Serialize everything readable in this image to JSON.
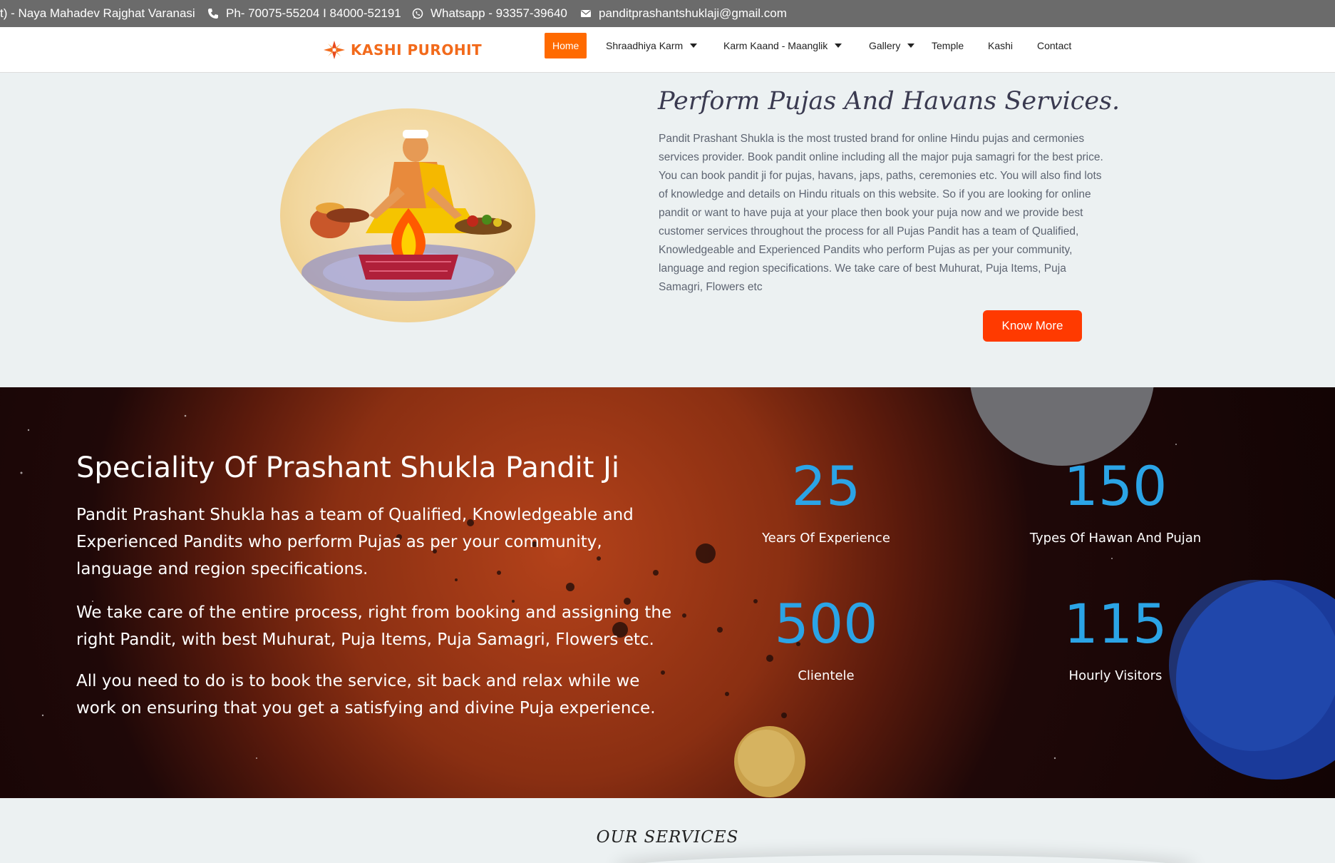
{
  "topbar": {
    "address": "t) - Naya Mahadev Rajghat Varanasi",
    "phone": "Ph- 70075-55204 I 84000-52191",
    "whatsapp": "Whatsapp - 93357-39640",
    "email": "panditprashantshuklaji@gmail.com",
    "icons": [
      "phone-icon",
      "whatsapp-icon",
      "envelope-icon"
    ]
  },
  "nav": {
    "logo_text": "KASHI PUROHIT",
    "items": [
      {
        "label": "Home",
        "active": true,
        "dropdown": false
      },
      {
        "label": "Shraadhiya Karm",
        "active": false,
        "dropdown": true
      },
      {
        "label": "Karm Kaand - Maanglik",
        "active": false,
        "dropdown": true
      },
      {
        "label": "Gallery",
        "active": false,
        "dropdown": true
      },
      {
        "label": "Temple",
        "active": false,
        "dropdown": false
      },
      {
        "label": "Kashi",
        "active": false,
        "dropdown": false
      },
      {
        "label": "Contact",
        "active": false,
        "dropdown": false
      }
    ],
    "accent_color": "#ff6a00"
  },
  "intro": {
    "title": "Perform Pujas And Havans Services.",
    "body": "Pandit Prashant Shukla is the most trusted brand for online Hindu pujas and cermonies services provider. Book pandit online including all the major puja samagri for the best price. You can book pandit ji for pujas, havans, japs, paths, ceremonies etc. You will also find lots of knowledge and details on Hindu rituals on this website. So if you are looking for online pandit or want to have puja at your place then book your puja now and we provide best customer services throughout the process for all Pujas Pandit has a team of Qualified, Knowledgeable and Experienced Pandits who perform Pujas as per your community, language and region specifications. We take care of best Muhurat, Puja Items, Puja Samagri, Flowers etc",
    "button_label": "Know More",
    "button_color": "#ff3a00"
  },
  "speciality": {
    "title": "Speciality Of Prashant Shukla Pandit Ji",
    "paragraphs": [
      "Pandit Prashant Shukla has a team of Qualified, Knowledgeable and Experienced Pandits who perform Pujas as per your community, language and region specifications.",
      "We take care of the entire process, right from booking and assigning the right Pandit, with best Muhurat, Puja Items, Puja Samagri, Flowers etc.",
      "All you need to do is to book the service, sit back and relax while we work on ensuring that you get a satisfying and divine Puja experience."
    ],
    "stats": [
      {
        "value": "25",
        "label": "Years Of Experience"
      },
      {
        "value": "150",
        "label": "Types Of Hawan And Pujan"
      },
      {
        "value": "500",
        "label": "Clientele"
      },
      {
        "value": "115",
        "label": "Hourly Visitors"
      }
    ],
    "stat_color": "#2ba4e6"
  },
  "services": {
    "title": "OUR SERVICES"
  }
}
